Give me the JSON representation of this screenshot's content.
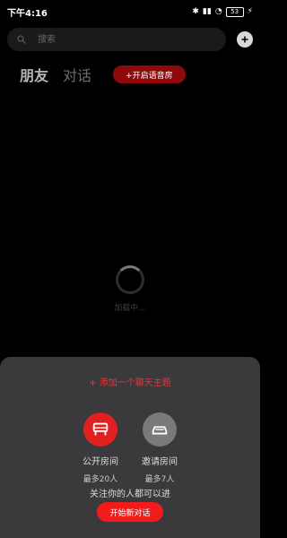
{
  "status": {
    "time": "下午4:16",
    "battery": "53"
  },
  "search": {
    "placeholder": "搜索"
  },
  "tabs": [
    {
      "label": "朋友"
    },
    {
      "label": "对话"
    }
  ],
  "voice_room_button": "+开启语音房",
  "loading_text": "加载中...",
  "sheet": {
    "add_topic": "+ 添加一个聊天主题",
    "public_room": {
      "title": "公开房间",
      "subtitle": "最多20人"
    },
    "invite_room": {
      "title": "邀请房间",
      "subtitle": "最多7人"
    },
    "followers_note": "关注你的人都可以进",
    "start_button": "开始新对话"
  },
  "colors": {
    "accent_red": "#e32020",
    "dark_red": "#8e0a0a",
    "sheet_bg": "#3a3a3c"
  },
  "icons": [
    "search-icon",
    "add-icon",
    "bluetooth-icon",
    "signal-icon",
    "wifi-icon",
    "battery-icon",
    "charging-icon",
    "public-room-icon",
    "invite-room-icon"
  ]
}
